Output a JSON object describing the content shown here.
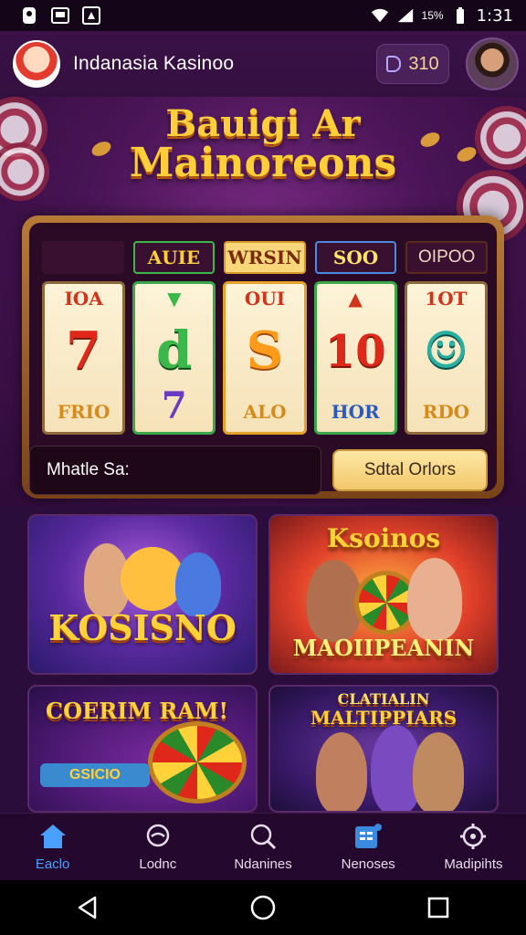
{
  "status_bar": {
    "battery_text": "15%",
    "time": "1:31"
  },
  "header": {
    "app_title": "Indanasia Kasinoo",
    "balance": "310"
  },
  "hero": {
    "title_line1": "Bauigi Ar",
    "title_line2": "Mainoreons",
    "reel_labels": [
      "AUIE",
      "WRSIN",
      "SOO",
      "OIPOO"
    ],
    "reels": [
      {
        "top": "IOA",
        "mid": "7",
        "bot": "FRIO"
      },
      {
        "top": "▼",
        "mid": "d",
        "bot": "7"
      },
      {
        "top": "OUI",
        "mid": "S",
        "bot": "ALO"
      },
      {
        "top": "▲",
        "mid": "10",
        "bot": "HOR"
      },
      {
        "top": "1OT",
        "mid": "☺",
        "bot": "RDO"
      }
    ],
    "bet_label": "Mhatle Sa:",
    "action_button": "Sdtal Orlors"
  },
  "games": [
    {
      "title": "KOSISNO"
    },
    {
      "title_top": "Ksoinos",
      "title_bottom": "MAOIIPEANIN"
    },
    {
      "title": "COERIM RAM!",
      "chip_text": "GSICIO"
    },
    {
      "title_line1": "CLATIALIN",
      "title_line2": "MALTIPPIARS"
    }
  ],
  "bottom_nav": [
    {
      "label": "Eaclo",
      "icon": "home-icon",
      "active": true
    },
    {
      "label": "Lodnc",
      "icon": "chat-icon",
      "active": false
    },
    {
      "label": "Ndanines",
      "icon": "search-icon",
      "active": false
    },
    {
      "label": "Nenoses",
      "icon": "promo-icon",
      "active": false
    },
    {
      "label": "Madipihts",
      "icon": "settings-icon",
      "active": false
    }
  ],
  "colors": {
    "accent": "#4aa0ff",
    "gold": "#ffcf3a",
    "background": "#2a0d3a"
  }
}
